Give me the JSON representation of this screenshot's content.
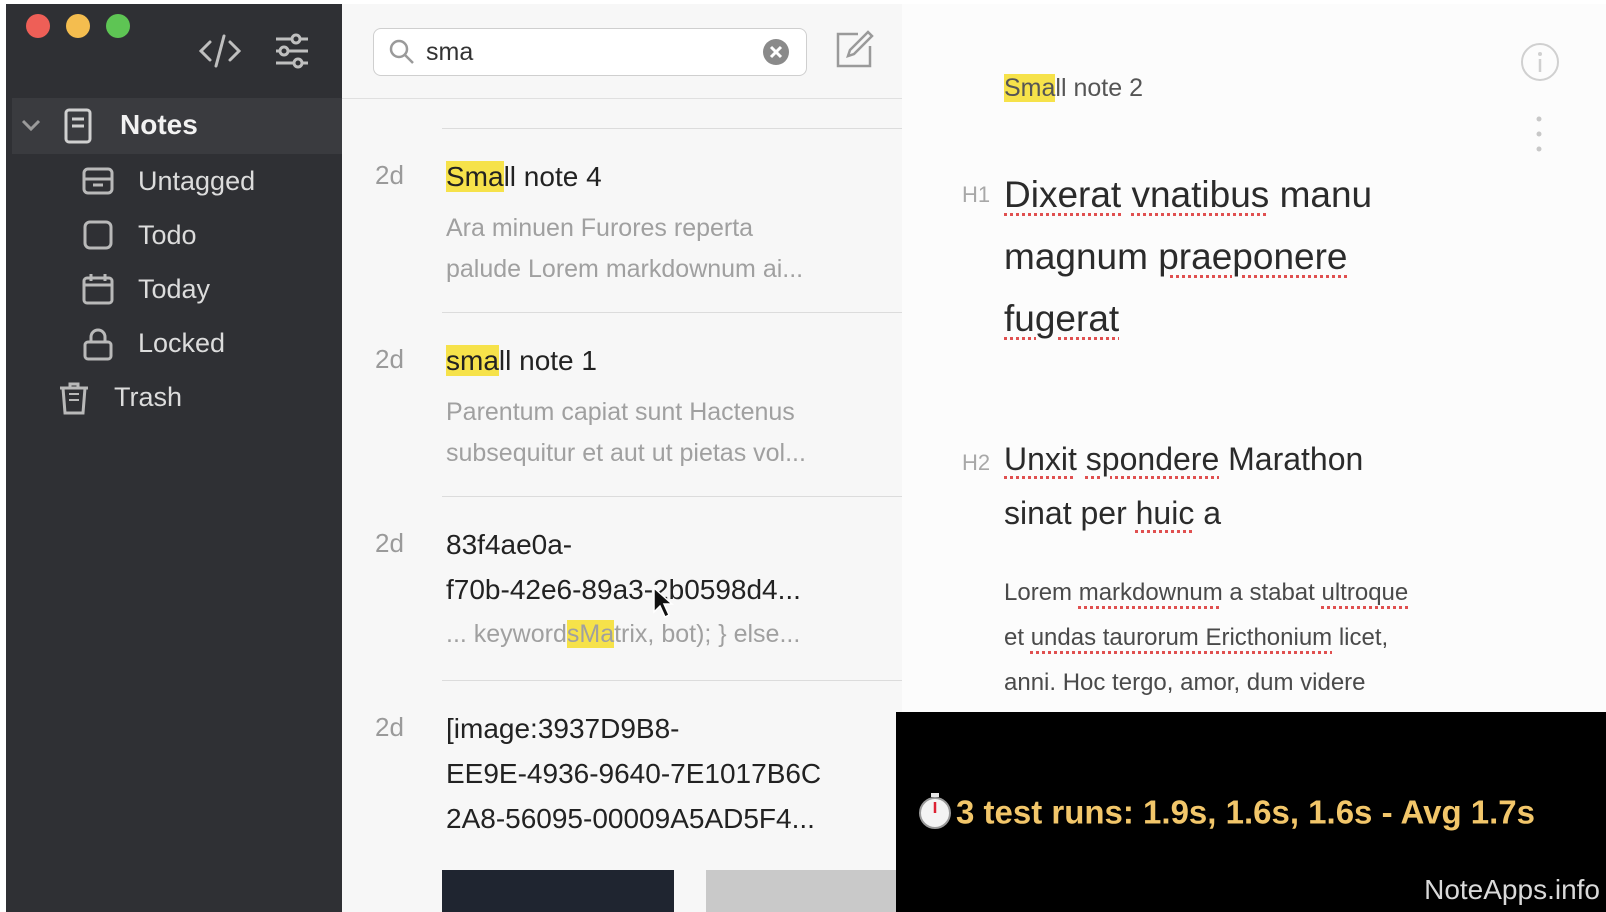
{
  "sidebar": {
    "notes_label": "Notes",
    "items": [
      {
        "label": "Untagged",
        "icon": "archive-box-icon"
      },
      {
        "label": "Todo",
        "icon": "checkbox-icon"
      },
      {
        "label": "Today",
        "icon": "calendar-icon"
      },
      {
        "label": "Locked",
        "icon": "lock-icon"
      }
    ],
    "trash_label": "Trash"
  },
  "search": {
    "value": "sma"
  },
  "notes": [
    {
      "age": "2d",
      "title_hl": "Sma",
      "title_rest": "ll note 4",
      "preview1": "Ara minuen Furores reperta",
      "preview2": "palude Lorem markdownum ai..."
    },
    {
      "age": "2d",
      "title_hl": "sma",
      "title_rest": "ll note 1",
      "preview1": "Parentum capiat sunt Hactenus",
      "preview2": "subsequitur et aut ut pietas vol..."
    },
    {
      "age": "2d",
      "title1": "83f4ae0a-",
      "title2": "f70b-42e6-89a3-2b0598d4...",
      "preview_pre": "... keyword",
      "preview_hl": "sMa",
      "preview_post": "trix, bot); } else..."
    },
    {
      "age": "2d",
      "title1": "[image:3937D9B8-",
      "title2": "EE9E-4936-9640-7E1017B6C",
      "title3": "2A8-56095-00009A5AD5F4..."
    }
  ],
  "editor": {
    "title_hl": "Sma",
    "title_rest": "ll note 2",
    "h1_mark": "H1",
    "h1_line1_a": "Dixerat",
    "h1_line1_b": "vnatibus",
    "h1_line1_c": "manu",
    "h1_line2_a": "magnum",
    "h1_line2_b": "praeponere",
    "h1_line3": "fugerat",
    "h2_mark": "H2",
    "h2_line1_a": "Unxit",
    "h2_line1_b": "spondere",
    "h2_line1_c": "Marathon",
    "h2_line2_a": "sinat per",
    "h2_line2_b": "huic",
    "h2_line2_c": "a",
    "p_line1_a": "Lorem",
    "p_line1_b": "markdownum",
    "p_line1_c": "a stabat",
    "p_line1_d": "ultroque",
    "p_line2_a": "et",
    "p_line2_b": "undas taurorum Ericthonium",
    "p_line2_c": "licet,",
    "p_line3": "anni. Hoc tergo, amor, dum videre"
  },
  "overlay": {
    "text": "3 test runs:  1.9s, 1.6s, 1.6s - Avg 1.7s",
    "icon": "stopwatch-icon"
  },
  "watermark": "NoteApps.info",
  "colors": {
    "sidebar": "#2f3034",
    "highlight": "#f6e24a",
    "overlay_text": "#f2c66a"
  }
}
